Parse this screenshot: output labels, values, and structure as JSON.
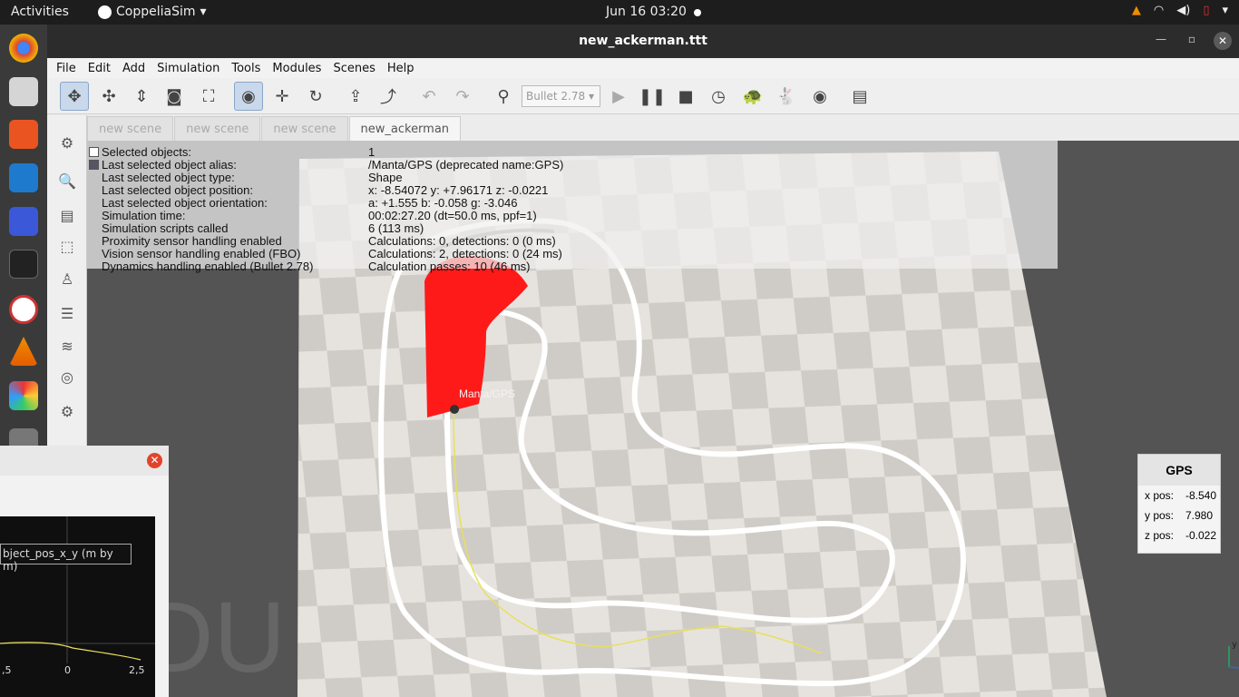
{
  "topbar": {
    "activities": "Activities",
    "app_name": "CoppeliaSim",
    "clock": "Jun 16  03:20"
  },
  "window": {
    "title": "new_ackerman.ttt"
  },
  "menu": [
    "File",
    "Edit",
    "Add",
    "Simulation",
    "Tools",
    "Modules",
    "Scenes",
    "Help"
  ],
  "toolbar": {
    "engine": "Bullet 2.78"
  },
  "tabs": [
    "new scene",
    "new scene",
    "new scene",
    "new_ackerman"
  ],
  "info": {
    "rows": [
      {
        "label": "Selected objects:",
        "value": "1"
      },
      {
        "label": "Last selected object alias:",
        "value": "/Manta/GPS    (deprecated name:GPS)"
      },
      {
        "label": "Last selected object type:",
        "value": "Shape"
      },
      {
        "label": "Last selected object position:",
        "value": "x: -8.54072    y: +7.96171    z: -0.0221"
      },
      {
        "label": "Last selected object orientation:",
        "value": "a: +1.555    b: -0.058    g: -3.046"
      },
      {
        "label": "Simulation time:",
        "value": "00:02:27.20 (dt=50.0 ms, ppf=1)"
      },
      {
        "label": "Simulation scripts called",
        "value": "6 (113 ms)"
      },
      {
        "label": "Proximity sensor handling enabled",
        "value": "Calculations: 0, detections: 0 (0 ms)"
      },
      {
        "label": "Vision sensor handling enabled (FBO)",
        "value": "Calculations: 2, detections: 0 (24 ms)"
      },
      {
        "label": "Dynamics handling enabled (Bullet 2.78)",
        "value": "Calculation passes: 10 (46 ms)"
      }
    ]
  },
  "scene": {
    "object_label": "Manta/GPS",
    "watermark": "DU"
  },
  "gps_panel": {
    "title": "GPS",
    "x_label": "x pos:",
    "x_value": "-8.540",
    "y_label": "y pos:",
    "y_value": "7.980",
    "z_label": "z pos:",
    "z_value": "-0.022"
  },
  "plot": {
    "series_label": "bject_pos_x_y (m by m)",
    "ticks": [
      ",5",
      "0",
      "2,5"
    ]
  },
  "colors": {
    "path": "#e8e05a",
    "red_zone": "#ff1a1a",
    "track": "#ffffff"
  }
}
